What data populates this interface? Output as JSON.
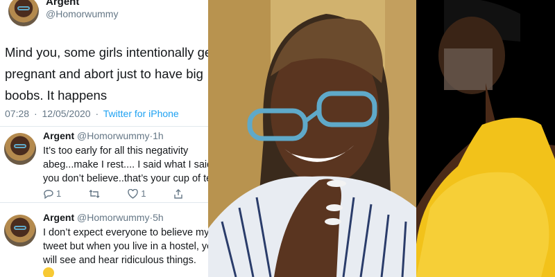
{
  "tweet": {
    "display_name": "Argent",
    "handle": "@Homorwummy",
    "text": "Mind you, some girls intentionally get\npregnant and abort just to have big\nboobs. It happens",
    "time": "07:28",
    "date": "12/05/2020",
    "source": "Twitter for iPhone"
  },
  "replies": [
    {
      "display_name": "Argent",
      "handle": "@Homorwummy",
      "age": "1h",
      "text": "It’s too early for all this negativity\nabeg...make I rest.... I said what I said\nyou don’t believe..that’s your cup of tea",
      "reply_count": "1",
      "like_count": "1"
    },
    {
      "display_name": "Argent",
      "handle": "@Homorwummy",
      "age": "5h",
      "text": "I don’t expect everyone to believe my\ntweet but when you live in a hostel, you\nwill see and hear ridiculous things.",
      "emoji": "grimacing-face"
    }
  ],
  "colors": {
    "link_blue": "#1da1f2",
    "muted": "#657786",
    "text": "#14171a",
    "dress_yellow": "#f2c21a"
  }
}
